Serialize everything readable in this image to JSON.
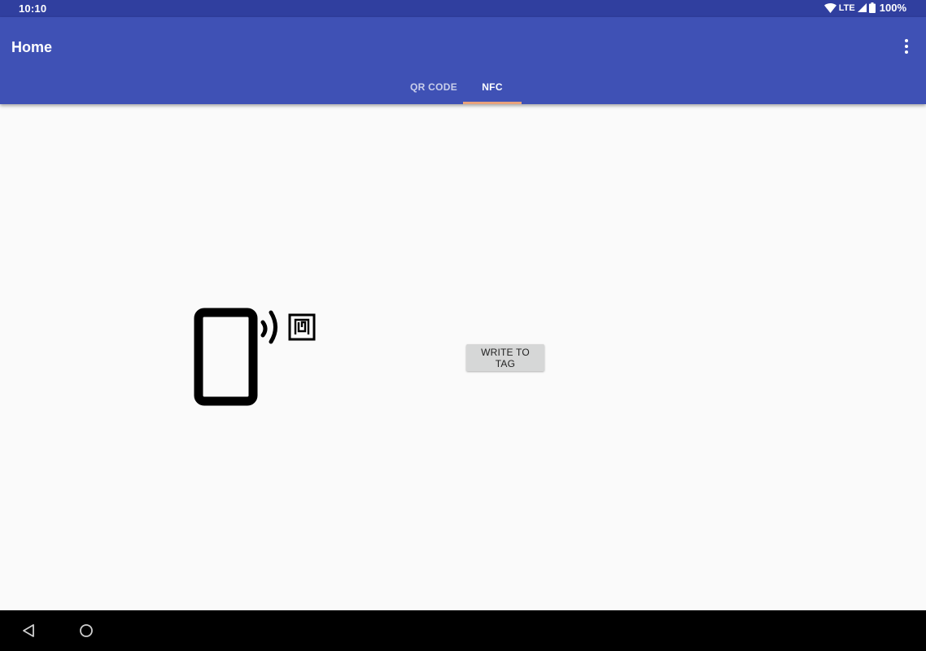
{
  "status_bar": {
    "time": "10:10",
    "network": "LTE",
    "battery": "100%"
  },
  "app_bar": {
    "title": "Home",
    "menu_icon": "more-vert-icon"
  },
  "tabs": [
    {
      "label": "QR CODE",
      "selected": false
    },
    {
      "label": "NFC",
      "selected": true
    }
  ],
  "colors": {
    "status_bar": "#303f9f",
    "app_bar": "#3f51b5",
    "tab_indicator": "#e8a27c",
    "background": "#fafafa",
    "button": "#d6d7d7"
  },
  "main": {
    "illustration_icon": "nfc-tap-phone-icon",
    "write_button_label": "WRITE TO TAG"
  },
  "nav_bar": {
    "back_icon": "back-triangle-icon",
    "home_icon": "home-circle-icon"
  }
}
